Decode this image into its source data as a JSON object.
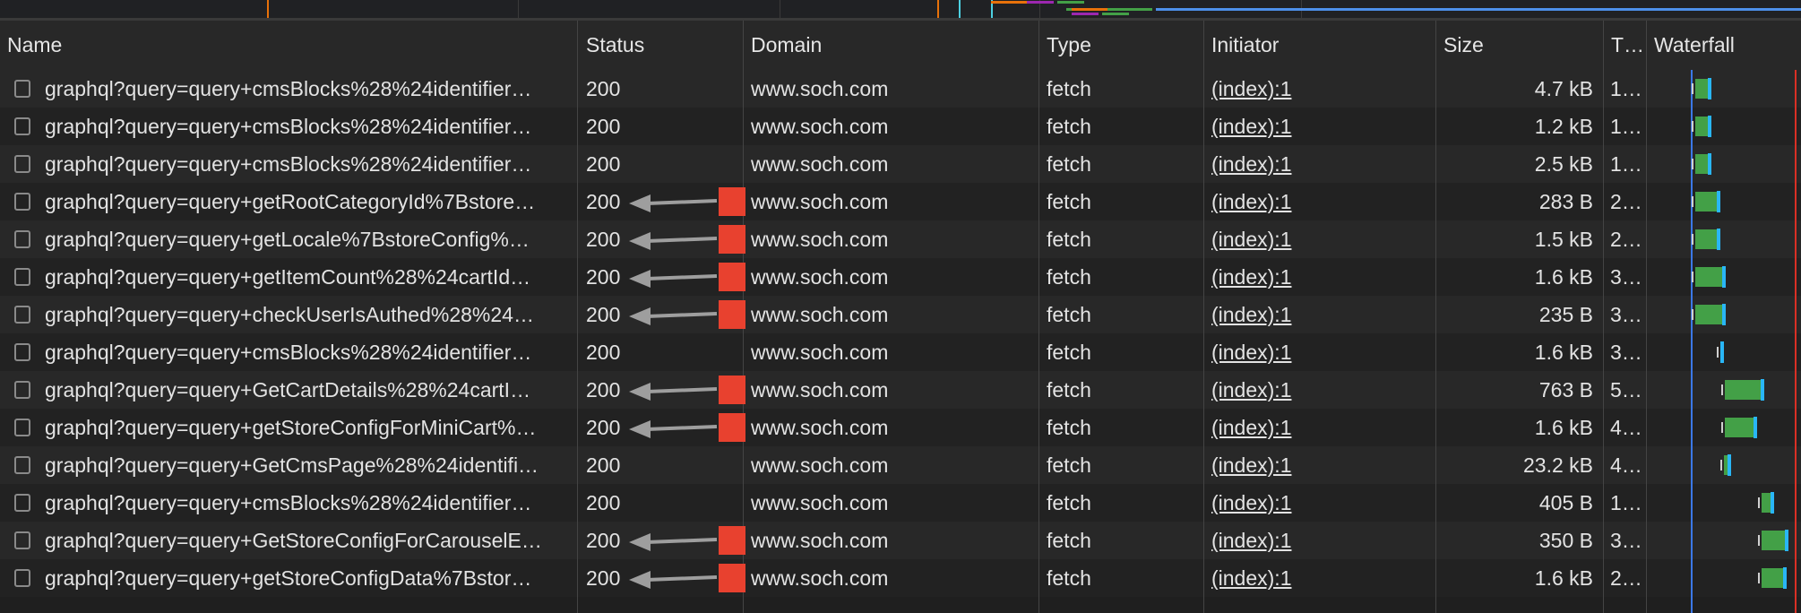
{
  "columns": {
    "name": "Name",
    "status": "Status",
    "domain": "Domain",
    "type": "Type",
    "initiator": "Initiator",
    "size": "Size",
    "time": "T…",
    "waterfall": "Waterfall"
  },
  "rows": [
    {
      "name": "graphql?query=query+cmsBlocks%28%24identifier…",
      "status": "200",
      "domain": "www.soch.com",
      "type": "fetch",
      "initiator": "(index):1",
      "size": "4.7 kB",
      "time": "1…",
      "annotated": false
    },
    {
      "name": "graphql?query=query+cmsBlocks%28%24identifier…",
      "status": "200",
      "domain": "www.soch.com",
      "type": "fetch",
      "initiator": "(index):1",
      "size": "1.2 kB",
      "time": "1…",
      "annotated": false
    },
    {
      "name": "graphql?query=query+cmsBlocks%28%24identifier…",
      "status": "200",
      "domain": "www.soch.com",
      "type": "fetch",
      "initiator": "(index):1",
      "size": "2.5 kB",
      "time": "1…",
      "annotated": false
    },
    {
      "name": "graphql?query=query+getRootCategoryId%7Bstore…",
      "status": "200",
      "domain": "www.soch.com",
      "type": "fetch",
      "initiator": "(index):1",
      "size": "283 B",
      "time": "2…",
      "annotated": true
    },
    {
      "name": "graphql?query=query+getLocale%7BstoreConfig%…",
      "status": "200",
      "domain": "www.soch.com",
      "type": "fetch",
      "initiator": "(index):1",
      "size": "1.5 kB",
      "time": "2…",
      "annotated": true
    },
    {
      "name": "graphql?query=query+getItemCount%28%24cartId…",
      "status": "200",
      "domain": "www.soch.com",
      "type": "fetch",
      "initiator": "(index):1",
      "size": "1.6 kB",
      "time": "3…",
      "annotated": true
    },
    {
      "name": "graphql?query=query+checkUserIsAuthed%28%24…",
      "status": "200",
      "domain": "www.soch.com",
      "type": "fetch",
      "initiator": "(index):1",
      "size": "235 B",
      "time": "3…",
      "annotated": true
    },
    {
      "name": "graphql?query=query+cmsBlocks%28%24identifier…",
      "status": "200",
      "domain": "www.soch.com",
      "type": "fetch",
      "initiator": "(index):1",
      "size": "1.6 kB",
      "time": "3…",
      "annotated": false
    },
    {
      "name": "graphql?query=query+GetCartDetails%28%24cartI…",
      "status": "200",
      "domain": "www.soch.com",
      "type": "fetch",
      "initiator": "(index):1",
      "size": "763 B",
      "time": "5…",
      "annotated": true
    },
    {
      "name": "graphql?query=query+getStoreConfigForMiniCart%…",
      "status": "200",
      "domain": "www.soch.com",
      "type": "fetch",
      "initiator": "(index):1",
      "size": "1.6 kB",
      "time": "4…",
      "annotated": true
    },
    {
      "name": "graphql?query=query+GetCmsPage%28%24identifi…",
      "status": "200",
      "domain": "www.soch.com",
      "type": "fetch",
      "initiator": "(index):1",
      "size": "23.2 kB",
      "time": "4…",
      "annotated": false
    },
    {
      "name": "graphql?query=query+cmsBlocks%28%24identifier…",
      "status": "200",
      "domain": "www.soch.com",
      "type": "fetch",
      "initiator": "(index):1",
      "size": "405 B",
      "time": "1…",
      "annotated": false
    },
    {
      "name": "graphql?query=query+GetStoreConfigForCarouselE…",
      "status": "200",
      "domain": "www.soch.com",
      "type": "fetch",
      "initiator": "(index):1",
      "size": "350 B",
      "time": "3…",
      "annotated": true
    },
    {
      "name": "graphql?query=query+getStoreConfigData%7Bstor…",
      "status": "200",
      "domain": "www.soch.com",
      "type": "fetch",
      "initiator": "(index):1",
      "size": "1.6 kB",
      "time": "2…",
      "annotated": true
    }
  ],
  "colors": {
    "waterfall_bar": "#43a047",
    "waterfall_tail": "#29b6f6",
    "annotation": "#e8412f",
    "arrow": "#9e9e9e"
  }
}
